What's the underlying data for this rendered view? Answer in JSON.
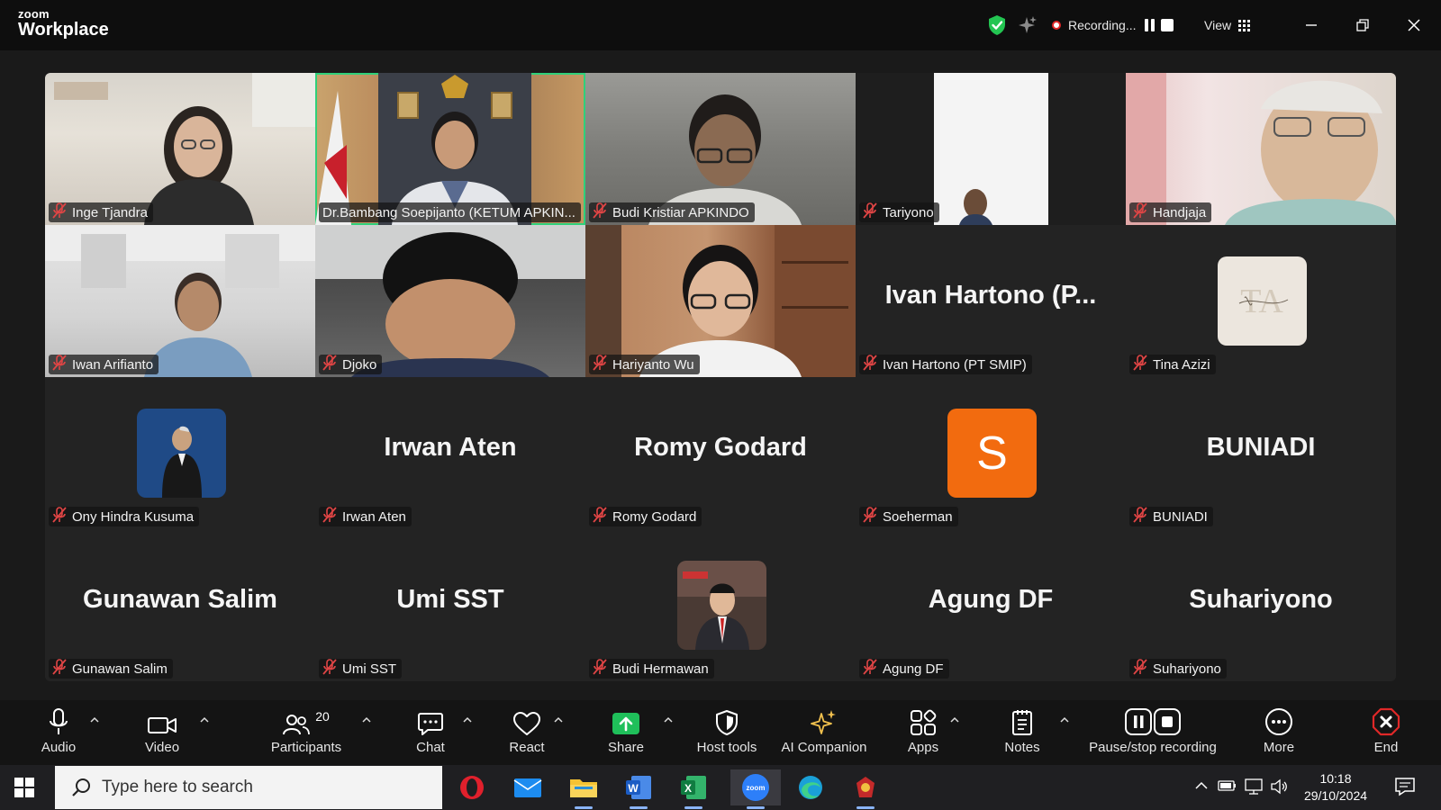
{
  "app": {
    "brand_small": "zoom",
    "brand_large": "Workplace"
  },
  "topbar": {
    "recording_label": "Recording...",
    "view_label": "View"
  },
  "participants": [
    {
      "name": "Inge Tjandra",
      "video": true,
      "bg": "inge"
    },
    {
      "name": "Dr.Bambang Soepijanto (KETUM APKIN...",
      "video": true,
      "bg": "bambang",
      "active": true
    },
    {
      "name": "Budi Kristiar APKINDO",
      "video": true,
      "bg": "budi"
    },
    {
      "name": "Tariyono",
      "video": true,
      "bg": "tari"
    },
    {
      "name": "Handjaja",
      "video": true,
      "bg": "handjaja"
    },
    {
      "name": "Iwan Arifianto",
      "video": true,
      "bg": "iwan"
    },
    {
      "name": "Djoko",
      "video": true,
      "bg": "djoko"
    },
    {
      "name": "Hariyanto Wu",
      "video": true,
      "bg": "hari"
    },
    {
      "name": "Ivan Hartono (PT SMIP)",
      "display": "Ivan Hartono (P..."
    },
    {
      "name": "Tina Azizi",
      "avatar": "tina"
    },
    {
      "name": "Ony Hindra Kusuma",
      "avatar": "ony"
    },
    {
      "name": "Irwan Aten",
      "display": "Irwan Aten"
    },
    {
      "name": "Romy Godard",
      "display": "Romy Godard"
    },
    {
      "name": "Soeherman",
      "avatar": "letter",
      "letter": "S",
      "avatar_color": "#f26b0f"
    },
    {
      "name": "BUNIADI",
      "display": "BUNIADI"
    },
    {
      "name": "Gunawan Salim",
      "display": "Gunawan Salim"
    },
    {
      "name": "Umi SST",
      "display": "Umi SST"
    },
    {
      "name": "Budi Hermawan",
      "avatar": "budih"
    },
    {
      "name": "Agung DF",
      "display": "Agung DF"
    },
    {
      "name": "Suhariyono",
      "display": "Suhariyono"
    }
  ],
  "toolbar": {
    "audio": "Audio",
    "video": "Video",
    "participants": "Participants",
    "participants_count": "20",
    "chat": "Chat",
    "react": "React",
    "share": "Share",
    "host_tools": "Host tools",
    "ai_companion": "AI Companion",
    "apps": "Apps",
    "notes": "Notes",
    "pause_stop": "Pause/stop recording",
    "more": "More",
    "end": "End"
  },
  "taskbar": {
    "search_placeholder": "Type here to search",
    "time": "10:18",
    "date": "29/10/2024"
  },
  "colors": {
    "active_speaker": "#2fd07a",
    "share_green": "#1fbf5a",
    "end_red": "#e02828",
    "mic_muted": "#e04545"
  }
}
